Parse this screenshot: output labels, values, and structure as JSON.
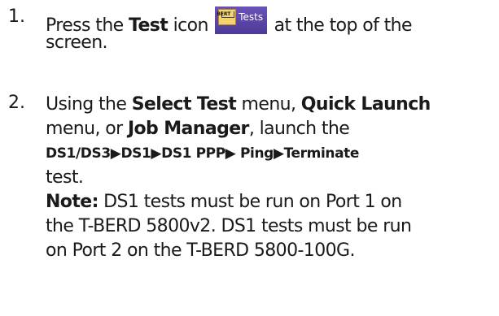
{
  "steps": [
    {
      "number": "1.",
      "line1_pre": "Press the ",
      "line1_bold": "Test",
      "line1_mid": " icon ",
      "icon": {
        "name": "tests-icon",
        "glyph_label": "BERT",
        "label": "Tests",
        "colors": {
          "background": "#5a45a8",
          "glyph": "#f3d36a"
        }
      },
      "line1_post": " at the top of the",
      "line2": "screen."
    },
    {
      "number": "2.",
      "l1_pre": "Using the ",
      "l1_b1": "Select Test",
      "l1_mid": " menu, ",
      "l1_b2": "Quick Launch",
      "l2_pre": "menu, or ",
      "l2_b": "Job Manager",
      "l2_post": ", launch the",
      "path": "DS1/DS3▶DS1▶DS1 PPP▶ Ping▶Terminate",
      "l4": "test.",
      "note_label": "Note:",
      "note_l1": " DS1 tests must be run on Port 1 on",
      "note_l2": "the T-BERD 5800v2.  DS1 tests must be run",
      "note_l3": "on Port 2 on the T-BERD 5800-100G."
    }
  ]
}
